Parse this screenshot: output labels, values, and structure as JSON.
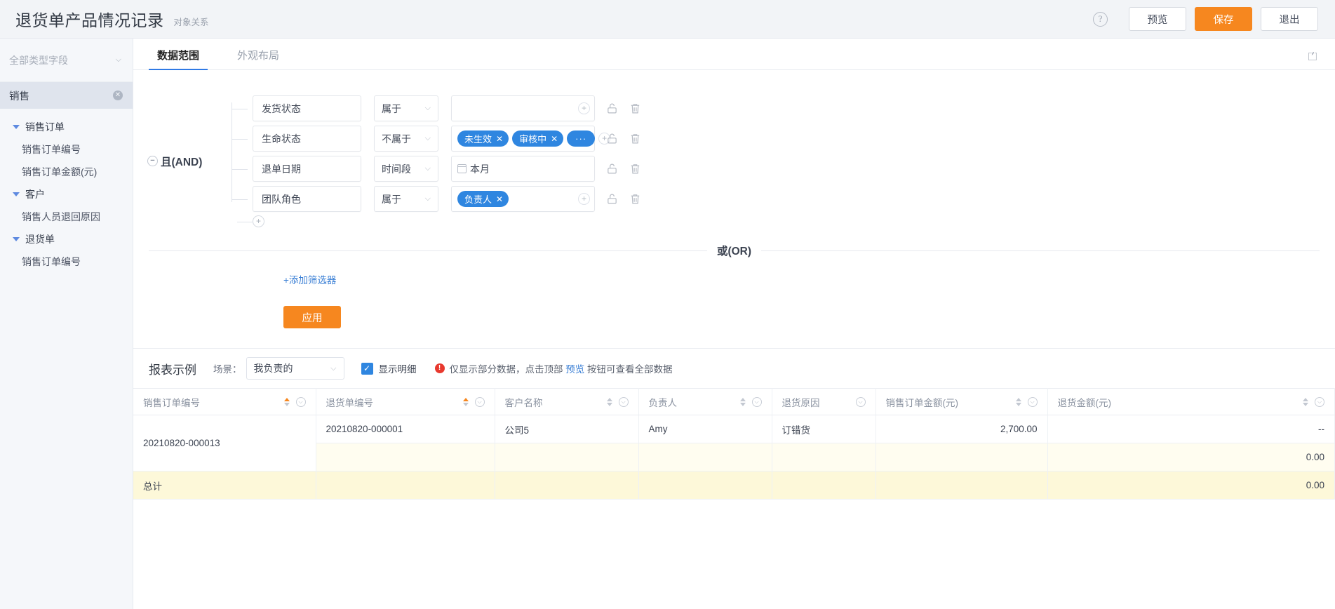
{
  "header": {
    "title": "退货单产品情况记录",
    "subtitle": "对象关系",
    "help_icon": "question-mark-icon",
    "preview_label": "预览",
    "save_label": "保存",
    "exit_label": "退出",
    "accent_color": "#f6871f"
  },
  "sidebar": {
    "field_type_placeholder": "全部类型字段",
    "module": {
      "label": "销售",
      "close_icon": "close-circle-icon"
    },
    "tree": [
      {
        "label": "销售订单",
        "type": "group",
        "expanded": true
      },
      {
        "label": "销售订单编号",
        "type": "leaf"
      },
      {
        "label": "销售订单金额(元)",
        "type": "leaf"
      },
      {
        "label": "客户",
        "type": "group",
        "expanded": true
      },
      {
        "label": "销售人员退回原因",
        "type": "leaf"
      },
      {
        "label": "退货单",
        "type": "group",
        "expanded": true
      },
      {
        "label": "销售订单编号",
        "type": "leaf"
      }
    ]
  },
  "tabs": {
    "items": [
      {
        "label": "数据范围",
        "active": true
      },
      {
        "label": "外观布局",
        "active": false
      }
    ],
    "collapse_icon": "chevron-double-up-icon"
  },
  "filters": {
    "group_label": "且(AND)",
    "rows": [
      {
        "field": "发货状态",
        "operator": "属于",
        "tags": [],
        "date_value": "",
        "has_add": true,
        "lock_icon": "lock-icon",
        "delete_icon": "trash-icon"
      },
      {
        "field": "生命状态",
        "operator": "不属于",
        "tags": [
          "未生效",
          "审核中"
        ],
        "overflow_tag": "···",
        "date_value": "",
        "has_add": true,
        "lock_icon": "lock-icon",
        "delete_icon": "trash-icon"
      },
      {
        "field": "退单日期",
        "operator": "时间段",
        "tags": [],
        "date_value": "本月",
        "has_add": false,
        "lock_icon": "lock-icon",
        "delete_icon": "trash-icon"
      },
      {
        "field": "团队角色",
        "operator": "属于",
        "tags": [
          "负责人"
        ],
        "date_value": "",
        "has_add": true,
        "lock_icon": "lock-icon",
        "delete_icon": "trash-icon"
      }
    ],
    "add_row_icon": "plus-circle-icon",
    "or_label": "或(OR)",
    "add_filter_label": "+添加筛选器",
    "apply_label": "应用"
  },
  "report": {
    "title": "报表示例",
    "scene_label": "场景：",
    "scene_value": "我负责的",
    "show_detail_checked": true,
    "show_detail_label": "显示明细",
    "warning_prefix": "仅显示部分数据，点击顶部 ",
    "warning_link": "预览",
    "warning_suffix": " 按钮可查看全部数据",
    "columns": [
      {
        "label": "销售订单编号",
        "sortable": true,
        "sort_active": true,
        "filterable": true,
        "align": "left"
      },
      {
        "label": "退货单编号",
        "sortable": true,
        "sort_active": true,
        "filterable": true,
        "align": "left"
      },
      {
        "label": "客户名称",
        "sortable": true,
        "sort_active": false,
        "filterable": true,
        "align": "left"
      },
      {
        "label": "负责人",
        "sortable": true,
        "sort_active": false,
        "filterable": true,
        "align": "left"
      },
      {
        "label": "退货原因",
        "sortable": false,
        "sort_active": false,
        "filterable": true,
        "align": "left"
      },
      {
        "label": "销售订单金额(元)",
        "sortable": true,
        "sort_active": false,
        "filterable": true,
        "align": "left"
      },
      {
        "label": "退货金额(元)",
        "sortable": true,
        "sort_active": false,
        "filterable": true,
        "align": "left"
      }
    ],
    "rows": [
      {
        "sales_order_no": "20210820-000013",
        "return_order_no": "20210820-000001",
        "customer": "公司5",
        "owner": "Amy",
        "reason": "订错货",
        "order_amount": "2,700.00",
        "return_amount": "--"
      }
    ],
    "subtotal_value": "0.00",
    "total_label": "总计",
    "total_value": "0.00"
  }
}
